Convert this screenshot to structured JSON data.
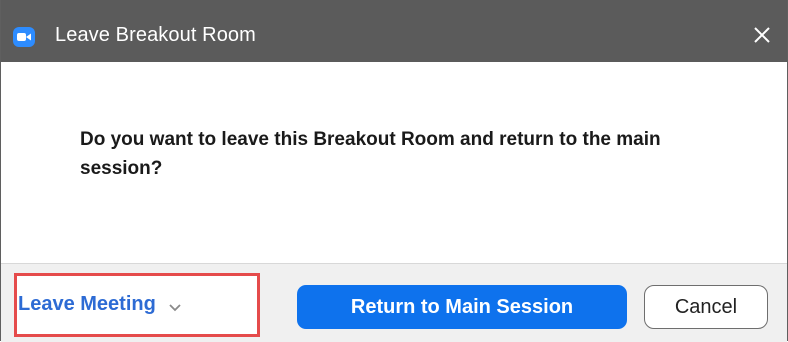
{
  "window": {
    "title": "Leave Breakout Room",
    "app_icon": "zoom-camera-icon",
    "close_icon": "close-icon"
  },
  "dialog": {
    "message": "Do you want to leave this Breakout Room and return to the main session?"
  },
  "footer": {
    "leave_meeting_label": "Leave Meeting",
    "leave_meeting_chevron": "chevron-down-icon",
    "return_label": "Return to Main Session",
    "cancel_label": "Cancel"
  },
  "colors": {
    "titlebar": "#5b5b5b",
    "accent_blue": "#0e72ed",
    "link_blue": "#2d6bd4",
    "highlight_red": "#e54b4b",
    "footer_bg": "#f0f0f0"
  }
}
